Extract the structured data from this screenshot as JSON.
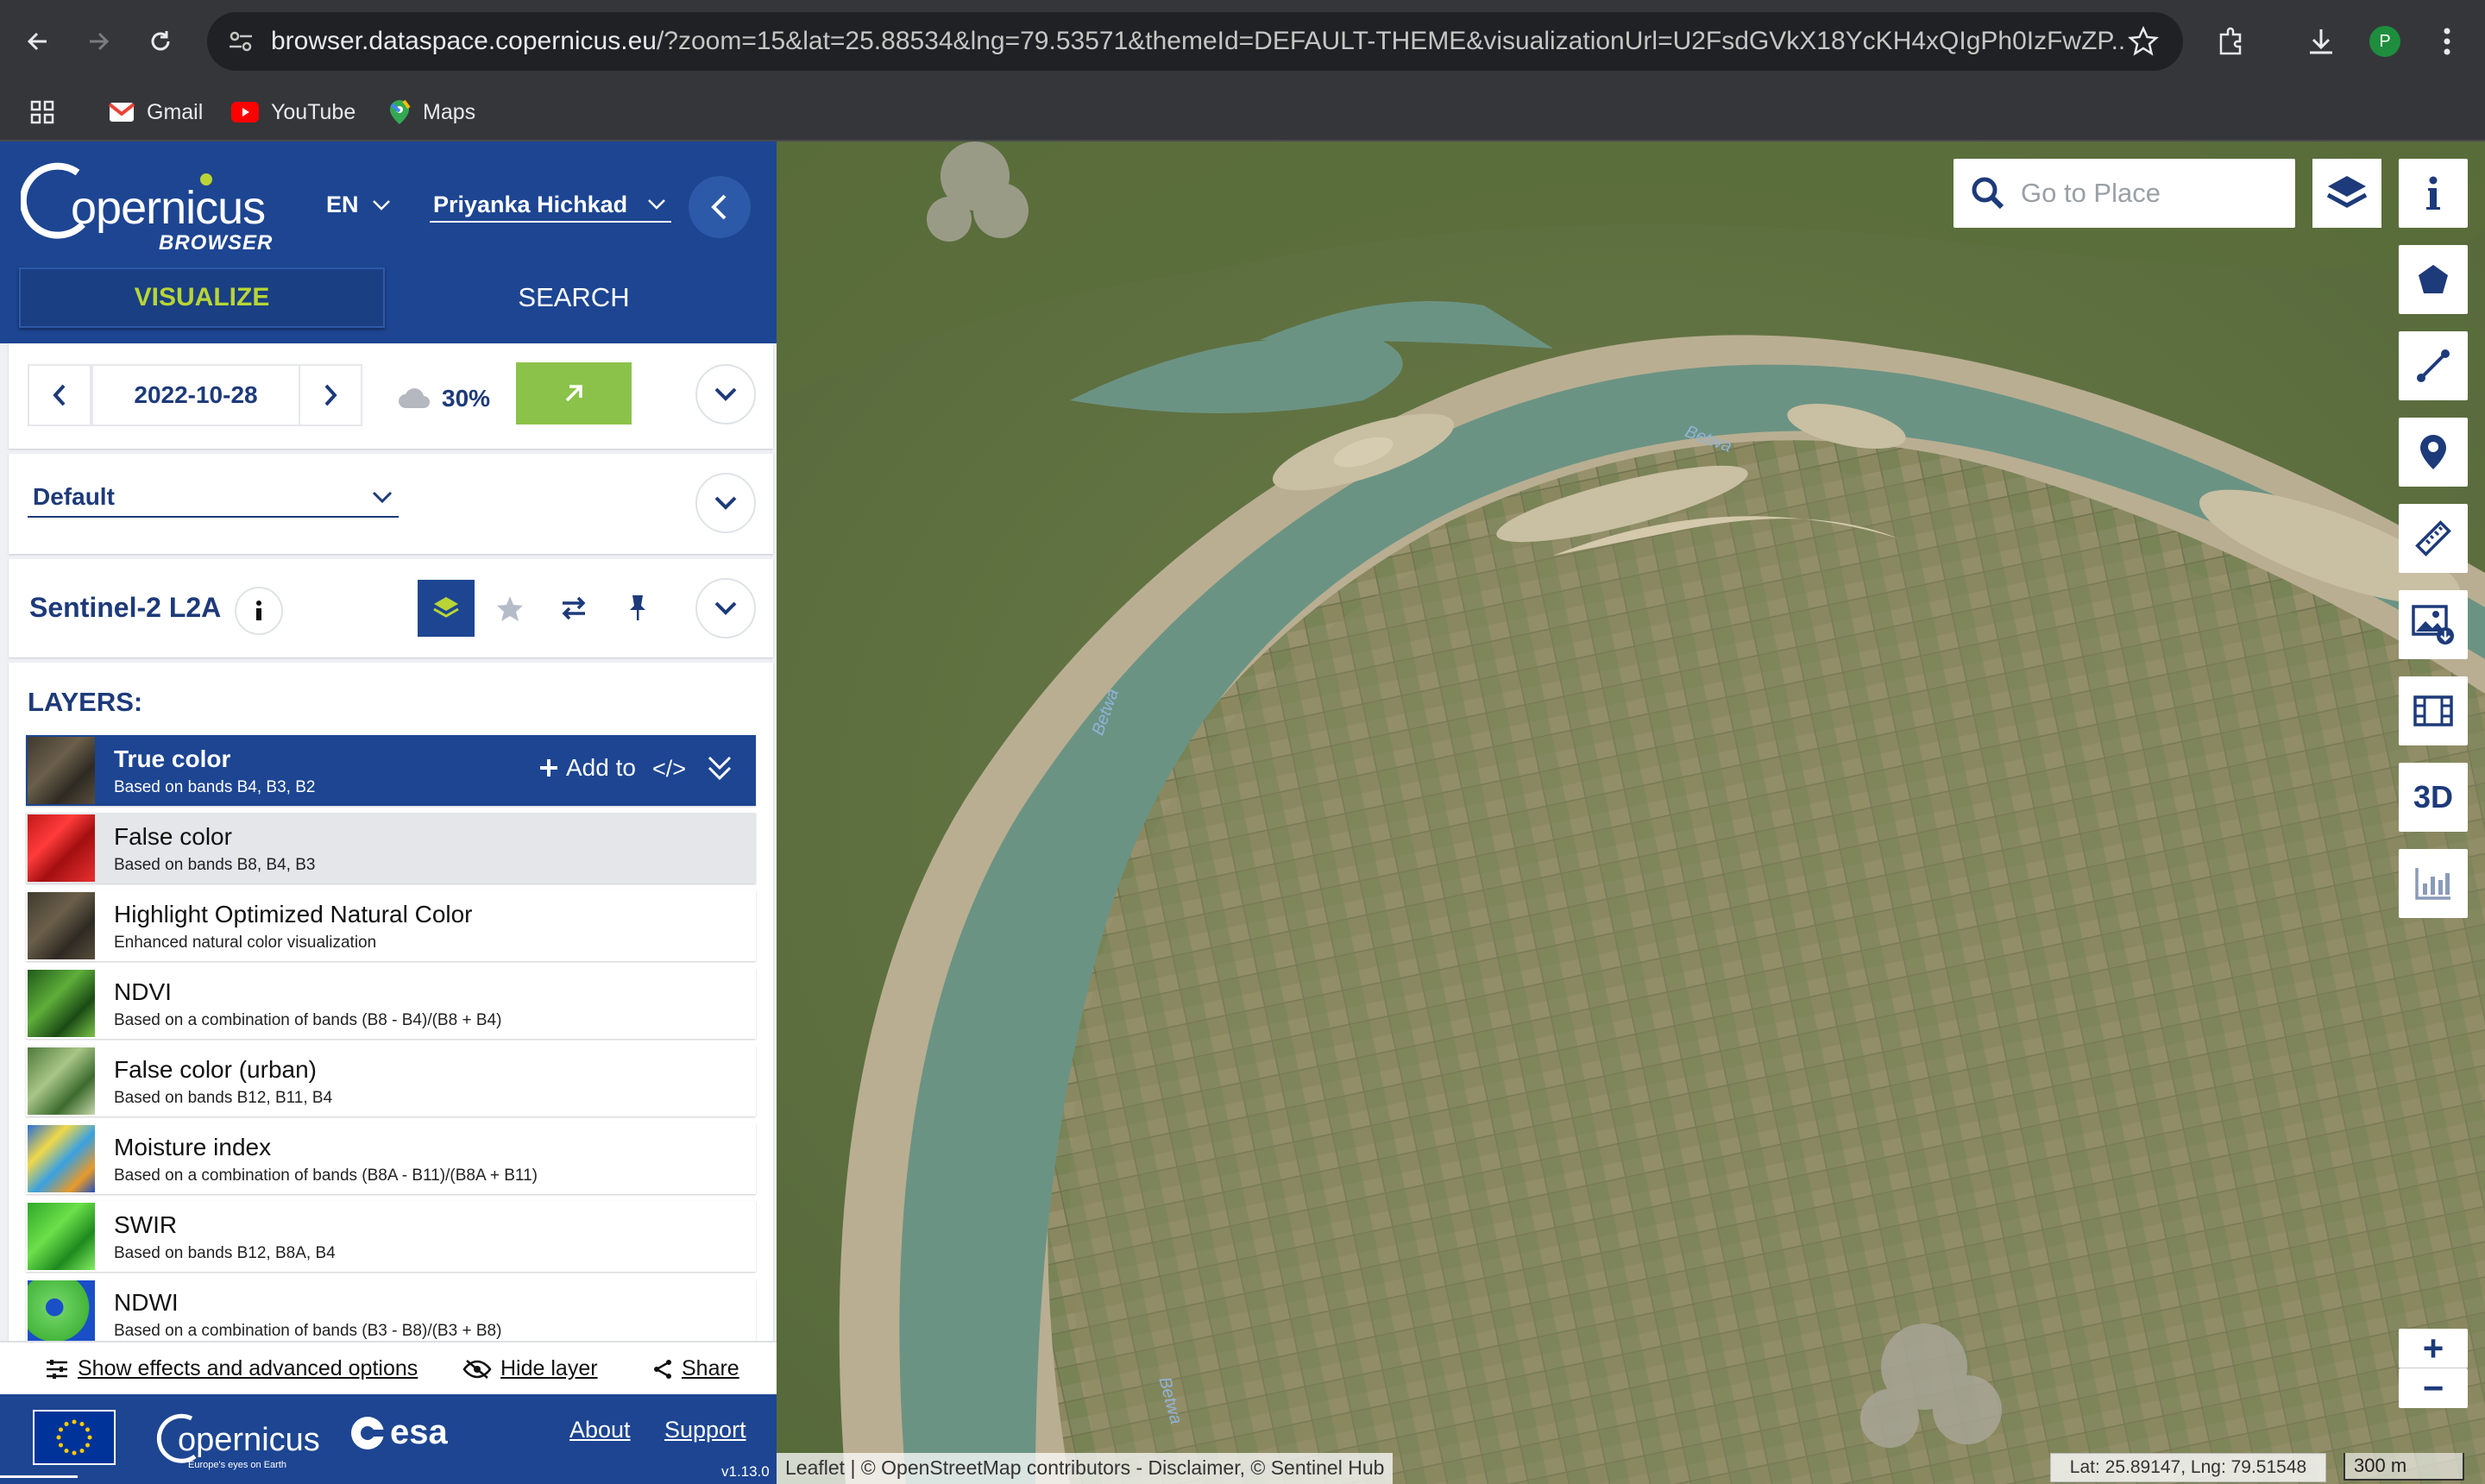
{
  "browser": {
    "url_domain": "browser.dataspace.copernicus.eu",
    "url_rest": "/?zoom=15&lat=25.88534&lng=79.53571&themeId=DEFAULT-THEME&visualizationUrl=U2FsdGVkX18YcKH4xQIgPh0IzFwZP...",
    "profile_initial": "P",
    "bookmarks": [
      "Gmail",
      "YouTube",
      "Maps"
    ]
  },
  "header": {
    "logo_text": "opernicus",
    "logo_sub": "BROWSER",
    "language": "EN",
    "user": "Priyanka Hichkad",
    "tabs": {
      "visualize": "VISUALIZE",
      "search": "SEARCH"
    }
  },
  "date_bar": {
    "date": "2022-10-28",
    "cloud": "30%"
  },
  "theme": {
    "selected": "Default"
  },
  "dataset": {
    "name": "Sentinel-2 L2A"
  },
  "layers": {
    "title": "LAYERS:",
    "add_to": "Add to",
    "code": "</>",
    "items": [
      {
        "name": "True color",
        "desc": "Based on bands B4, B3, B2"
      },
      {
        "name": "False color",
        "desc": "Based on bands B8, B4, B3"
      },
      {
        "name": "Highlight Optimized Natural Color",
        "desc": "Enhanced natural color visualization"
      },
      {
        "name": "NDVI",
        "desc": "Based on a combination of bands (B8 - B4)/(B8 + B4)"
      },
      {
        "name": "False color (urban)",
        "desc": "Based on bands B12, B11, B4"
      },
      {
        "name": "Moisture index",
        "desc": "Based on a combination of bands (B8A - B11)/(B8A + B11)"
      },
      {
        "name": "SWIR",
        "desc": "Based on bands B12, B8A, B4"
      },
      {
        "name": "NDWI",
        "desc": "Based on a combination of bands (B3 - B8)/(B3 + B8)"
      }
    ]
  },
  "actions": {
    "effects": "Show effects and advanced options",
    "hide": "Hide layer",
    "share": "Share"
  },
  "footer": {
    "about": "About",
    "support": "Support",
    "version": "v1.13.0",
    "esa": "esa",
    "copernicus": "opernicus",
    "copernicus_tag": "Europe's eyes on Earth"
  },
  "map": {
    "search_placeholder": "Go to Place",
    "tool_3d": "3D",
    "river_labels": [
      "Betwa",
      "Betwa",
      "Betwa"
    ],
    "attribution": "Leaflet | © OpenStreetMap contributors - Disclaimer, © Sentinel Hub",
    "latlng": "Lat: 25.89147, Lng: 79.51548",
    "scale": "300 m",
    "zoom_in": "+",
    "zoom_out": "−"
  },
  "colors": {
    "brand_blue": "#1d4592",
    "accent_green": "#8bc34a",
    "lime": "#b8d535"
  }
}
